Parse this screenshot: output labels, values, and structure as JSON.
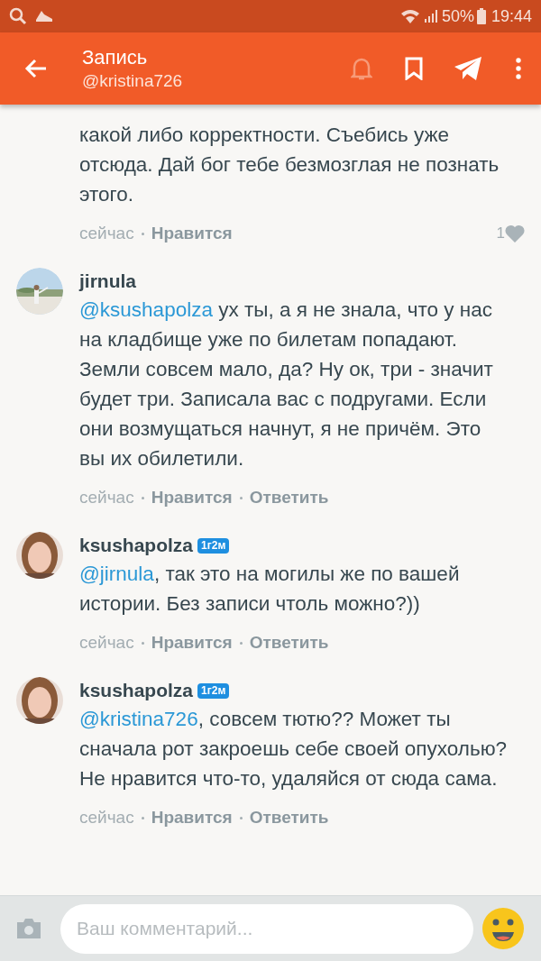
{
  "status_bar": {
    "battery": "50%",
    "time": "19:44"
  },
  "header": {
    "title": "Запись",
    "subtitle": "@kristina726",
    "notifications_on": false
  },
  "comments": [
    {
      "text": "какой либо корректности. Съебись уже отсюда. Дай бог тебе безмозглая не познать этого.",
      "time": "сейчас",
      "like": "Нравится",
      "likes": "1"
    },
    {
      "author": "jirnula",
      "mention": "@ksushapolza",
      "text": " ух ты, а я не знала, что у нас на кладбище уже по билетам попадают. Земли совсем мало, да? Ну ок, три - значит будет три. Записала вас с подругами. Если они возмущаться начнут, я не причём. Это вы их обилетили.",
      "time": "сейчас",
      "like": "Нравится",
      "reply": "Ответить"
    },
    {
      "author": "ksushapolza",
      "badge": "1г2м",
      "mention": "@jirnula",
      "text": ", так это на могилы же по вашей истории. Без записи чтоль можно?))",
      "time": "сейчас",
      "like": "Нравится",
      "reply": "Ответить"
    },
    {
      "author": "ksushapolza",
      "badge": "1г2м",
      "mention": "@kristina726",
      "text": ", совсем тютю?? Может ты сначала рот закроешь себе своей опухолью? Не нравится что-то, удаляйся от сюда сама.",
      "time": "сейчас",
      "like": "Нравится",
      "reply": "Ответить"
    }
  ],
  "composer": {
    "placeholder": "Ваш комментарий..."
  }
}
